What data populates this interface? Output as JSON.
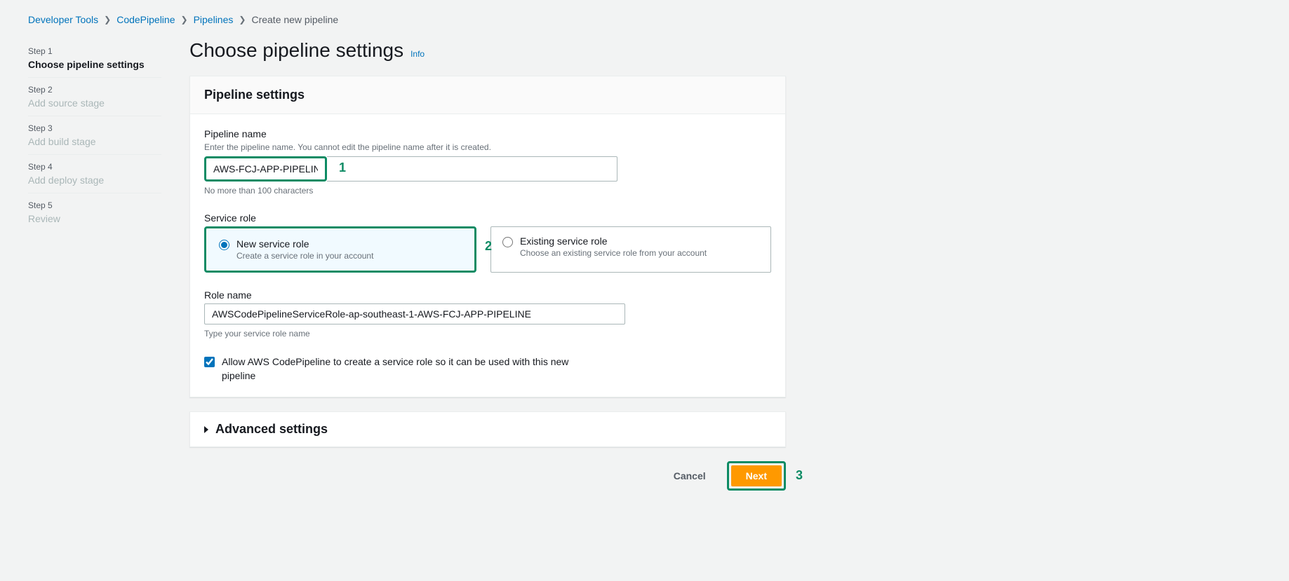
{
  "breadcrumb": {
    "items": [
      {
        "label": "Developer Tools"
      },
      {
        "label": "CodePipeline"
      },
      {
        "label": "Pipelines"
      },
      {
        "label": "Create new pipeline"
      }
    ]
  },
  "sidebar": {
    "steps": [
      {
        "label": "Step 1",
        "name": "Choose pipeline settings"
      },
      {
        "label": "Step 2",
        "name": "Add source stage"
      },
      {
        "label": "Step 3",
        "name": "Add build stage"
      },
      {
        "label": "Step 4",
        "name": "Add deploy stage"
      },
      {
        "label": "Step 5",
        "name": "Review"
      }
    ]
  },
  "page": {
    "title": "Choose pipeline settings",
    "info": "Info"
  },
  "panel": {
    "header": "Pipeline settings",
    "pipeline_name": {
      "label": "Pipeline name",
      "hint": "Enter the pipeline name. You cannot edit the pipeline name after it is created.",
      "value": "AWS-FCJ-APP-PIPELINE",
      "constraint": "No more than 100 characters"
    },
    "service_role": {
      "label": "Service role",
      "options": {
        "new": {
          "title": "New service role",
          "desc": "Create a service role in your account"
        },
        "existing": {
          "title": "Existing service role",
          "desc": "Choose an existing service role from your account"
        }
      }
    },
    "role_name": {
      "label": "Role name",
      "value": "AWSCodePipelineServiceRole-ap-southeast-1-AWS-FCJ-APP-PIPELINE",
      "constraint": "Type your service role name"
    },
    "checkbox": {
      "label": "Allow AWS CodePipeline to create a service role so it can be used with this new pipeline"
    }
  },
  "advanced": {
    "title": "Advanced settings"
  },
  "buttons": {
    "cancel": "Cancel",
    "next": "Next"
  },
  "annotations": {
    "one": "1",
    "two": "2",
    "three": "3"
  }
}
